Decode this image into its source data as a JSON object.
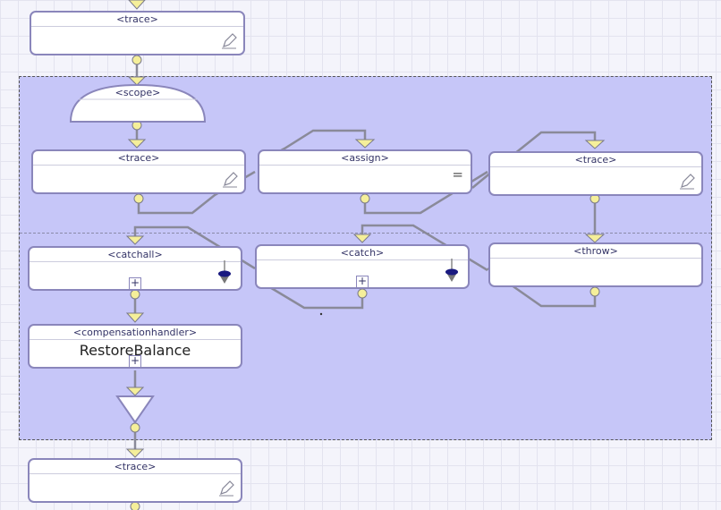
{
  "nodes": {
    "trace_top": {
      "title": "<trace>"
    },
    "scope": {
      "title": "<scope>"
    },
    "trace_left": {
      "title": "<trace>"
    },
    "assign": {
      "title": "<assign>",
      "symbol": "="
    },
    "trace_right": {
      "title": "<trace>"
    },
    "catchall": {
      "title": "<catchall>"
    },
    "catch": {
      "title": "<catch>"
    },
    "throw": {
      "title": "<throw>"
    },
    "compensationhandler": {
      "title": "<compensationhandler>",
      "body": "RestoreBalance"
    },
    "trace_bottom": {
      "title": "<trace>"
    }
  },
  "expand_symbol": "+",
  "colors": {
    "scope_fill": "#c6c6f8",
    "node_border": "#8a86bb",
    "connector_fill": "#f5ef9a",
    "wire": "#8a8a99"
  }
}
